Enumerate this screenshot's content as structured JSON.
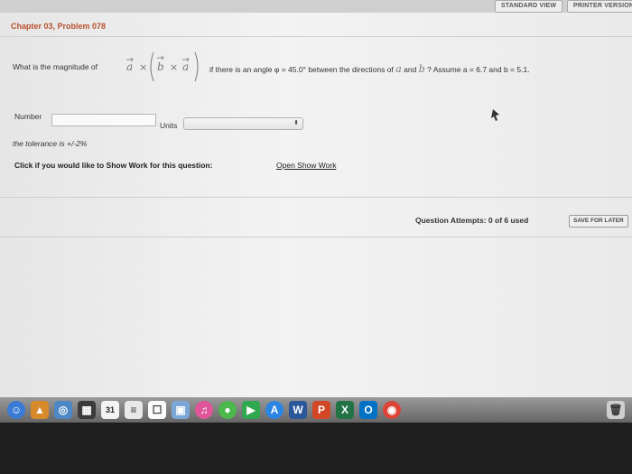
{
  "toolbar": {
    "standard_view": "STANDARD VIEW",
    "printer_version": "PRINTER VERSION"
  },
  "chapter_title": "Chapter 03, Problem 078",
  "question": {
    "lead": "What is the magnitude of",
    "vec_a": "a",
    "vec_b": "b",
    "times": "×",
    "part1": "if there is an angle φ = 45.0° between the directions of",
    "and": "and",
    "part2": "? Assume a = 6.7 and b = 5.1."
  },
  "answer": {
    "number_label": "Number",
    "number_value": "",
    "units_label": "Units",
    "units_value": ""
  },
  "tolerance": "the tolerance is +/-2%",
  "show_work": {
    "prompt": "Click if you would like to Show Work for this question:",
    "link": "Open Show Work"
  },
  "attempts": "Question Attempts: 0 of 6 used",
  "save_later": "SAVE FOR LATER",
  "dock": {
    "calendar_day": "31",
    "icons": [
      "finder-icon",
      "launchpad-icon",
      "safari-icon",
      "photos-icon",
      "calendar-icon",
      "notes-icon",
      "reminders-icon",
      "preview-icon",
      "itunes-icon",
      "messages-icon",
      "facetime-icon",
      "app-store-icon",
      "word-icon",
      "powerpoint-icon",
      "excel-icon",
      "outlook-icon",
      "chrome-icon",
      "trash-icon"
    ]
  }
}
